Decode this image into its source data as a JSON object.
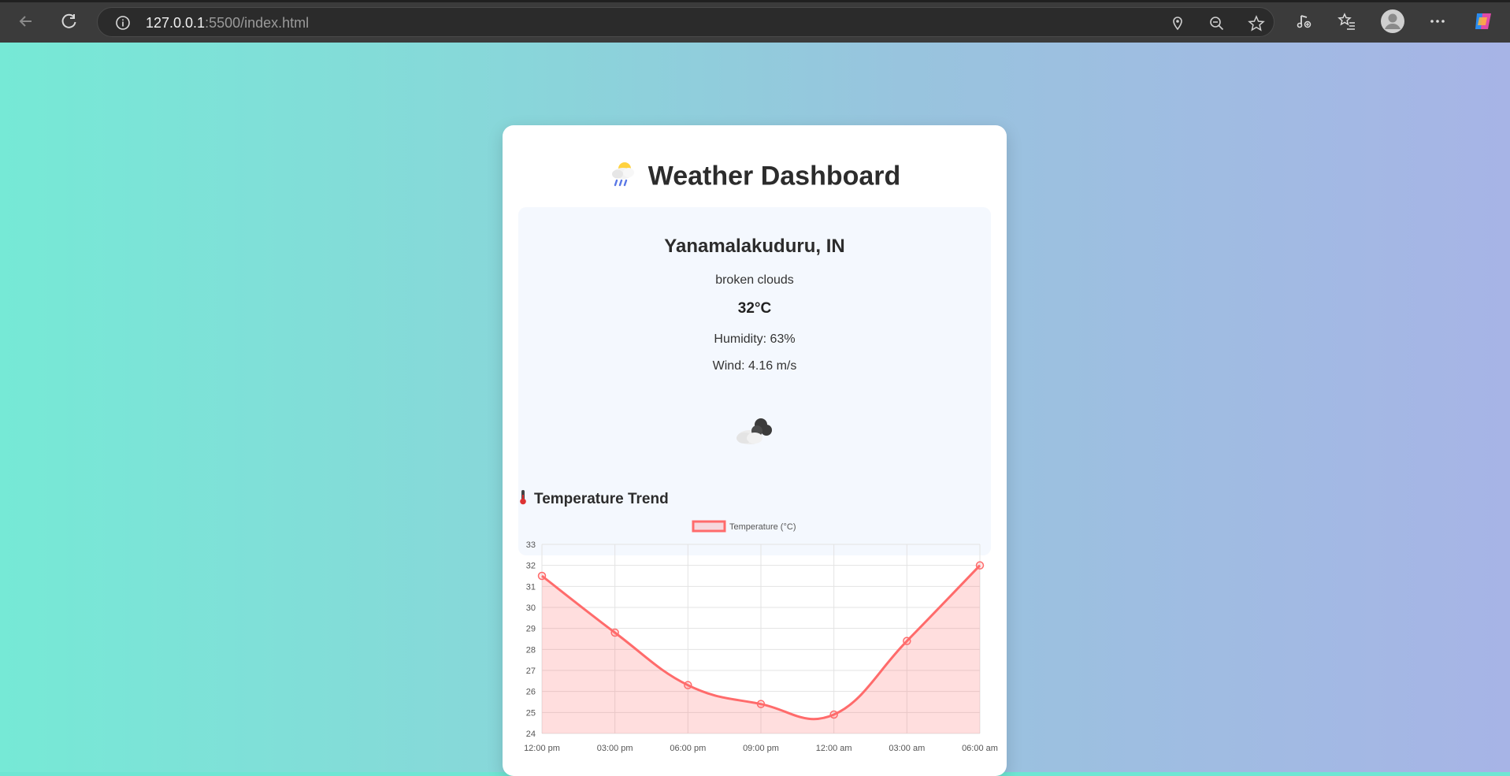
{
  "browser": {
    "url_host": "127.0.0.1",
    "url_rest": ":5500/index.html"
  },
  "page": {
    "title": "Weather Dashboard",
    "title_icon": "sun-behind-rain-cloud-icon"
  },
  "weather": {
    "city": "Yanamalakuduru, IN",
    "description": "broken clouds",
    "temperature": "32°C",
    "humidity": "Humidity: 63%",
    "wind": "Wind: 4.16 m/s",
    "icon": "broken-clouds-icon"
  },
  "trend": {
    "title": "Temperature Trend",
    "icon": "thermometer-icon"
  },
  "colors": {
    "line": "#ff6b6b",
    "fill": "rgba(255,107,107,0.22)",
    "grid": "#e3e3e3"
  },
  "chart_data": {
    "type": "line",
    "categories": [
      "12:00 pm",
      "03:00 pm",
      "06:00 pm",
      "09:00 pm",
      "12:00 am",
      "03:00 am",
      "06:00 am"
    ],
    "series": [
      {
        "name": "Temperature (°C)",
        "values": [
          31.5,
          28.8,
          26.3,
          25.4,
          24.9,
          28.4,
          32.0
        ]
      }
    ],
    "ylim": [
      24,
      33
    ],
    "yticks": [
      33,
      32,
      31,
      30,
      29,
      28,
      27,
      26,
      25,
      24
    ],
    "grid": true,
    "legend": "top-center",
    "fill": true
  }
}
